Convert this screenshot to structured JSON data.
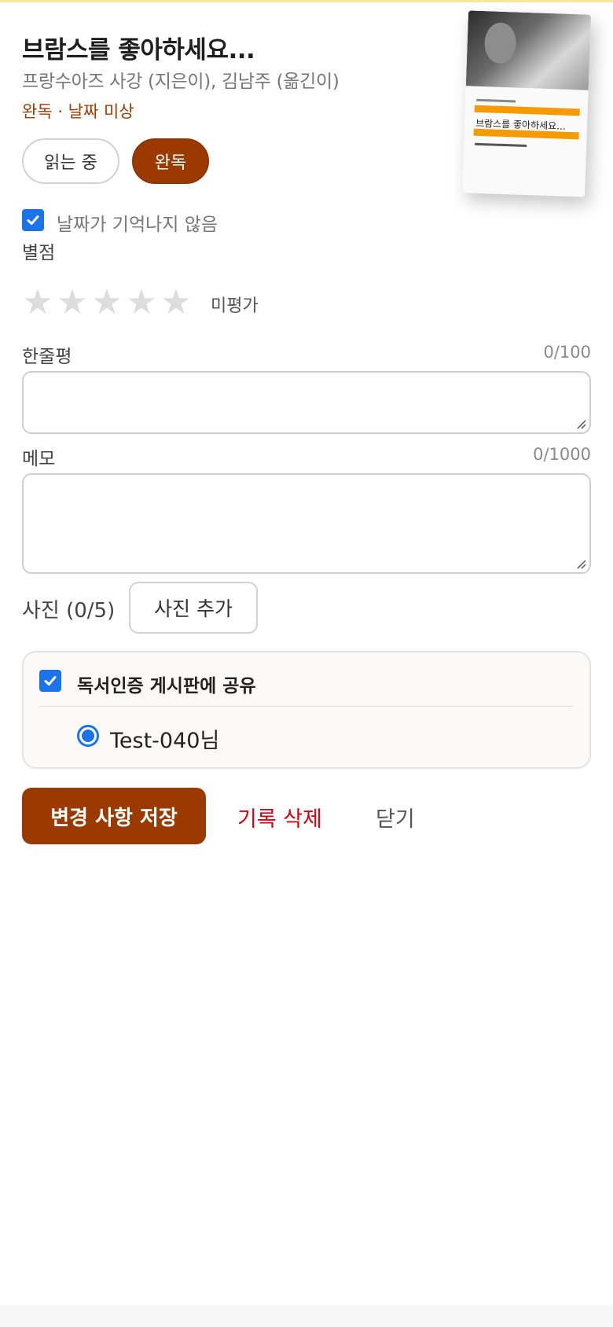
{
  "book": {
    "title": "브람스를 좋아하세요...",
    "authors": "프랑수아즈 사강 (지은이), 김남주 (옮긴이)",
    "status_line": "완독 · 날짜 미상",
    "cover_title": "브람스를 좋아하세요..."
  },
  "status_tabs": {
    "reading": "읽는 중",
    "done": "완독",
    "selected": "완독"
  },
  "no_date": {
    "label": "날짜가 기억나지 않음",
    "checked": true
  },
  "rating": {
    "label": "별점",
    "value": 0,
    "max": 5,
    "star_glyph": "★",
    "text": "미평가"
  },
  "one_liner": {
    "label": "한줄평",
    "counter": "0/100",
    "value": ""
  },
  "memo": {
    "label": "메모",
    "counter": "0/1000",
    "value": ""
  },
  "photos": {
    "label": "사진 (0/5)",
    "add_button": "사진 추가"
  },
  "share": {
    "label": "독서인증 게시판에 공유",
    "checked": true,
    "user": "Test-040님"
  },
  "actions": {
    "save": "변경 사항 저장",
    "delete": "기록 삭제",
    "close": "닫기"
  },
  "colors": {
    "accent": "#9a3a00",
    "danger": "#d6000f",
    "check": "#1a73e8"
  }
}
